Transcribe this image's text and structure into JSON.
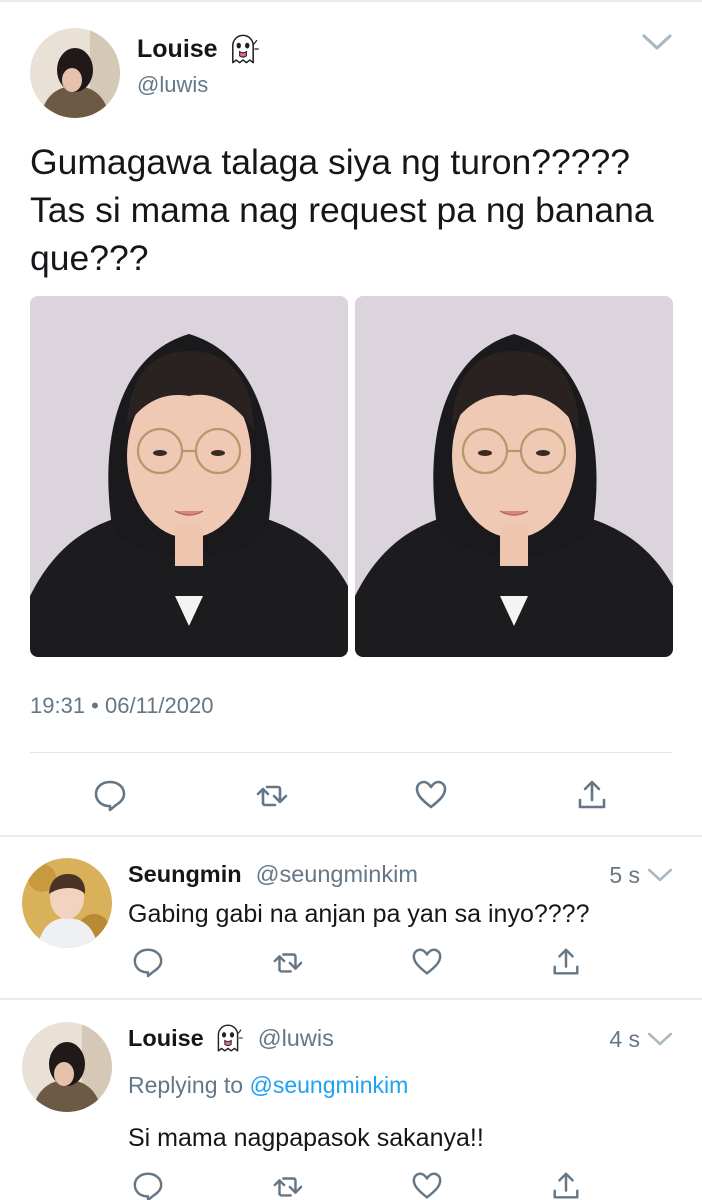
{
  "main_tweet": {
    "author_name": "Louise",
    "author_emoji": "ghost-emoji",
    "handle": "@luwis",
    "text": "Gumagawa talaga siya ng turon????? Tas si mama nag request pa ng banana que???",
    "timestamp": "19:31 • 06/11/2020",
    "icons": [
      "reply-icon",
      "retweet-icon",
      "like-icon",
      "share-icon"
    ]
  },
  "replies": [
    {
      "name": "Seungmin",
      "handle": "@seungminkim",
      "time": "5 s",
      "text": "Gabing gabi na anjan pa yan sa inyo????"
    },
    {
      "name": "Louise",
      "emoji": "ghost-emoji",
      "handle": "@luwis",
      "time": "4 s",
      "replying_prefix": "Replying to",
      "replying_to": "@seungminkim",
      "text": "Si mama nagpapasok sakanya!!"
    }
  ],
  "colors": {
    "text": "#14171a",
    "secondary": "#657786",
    "link": "#1da1f2",
    "divider": "#e6ecf0"
  }
}
